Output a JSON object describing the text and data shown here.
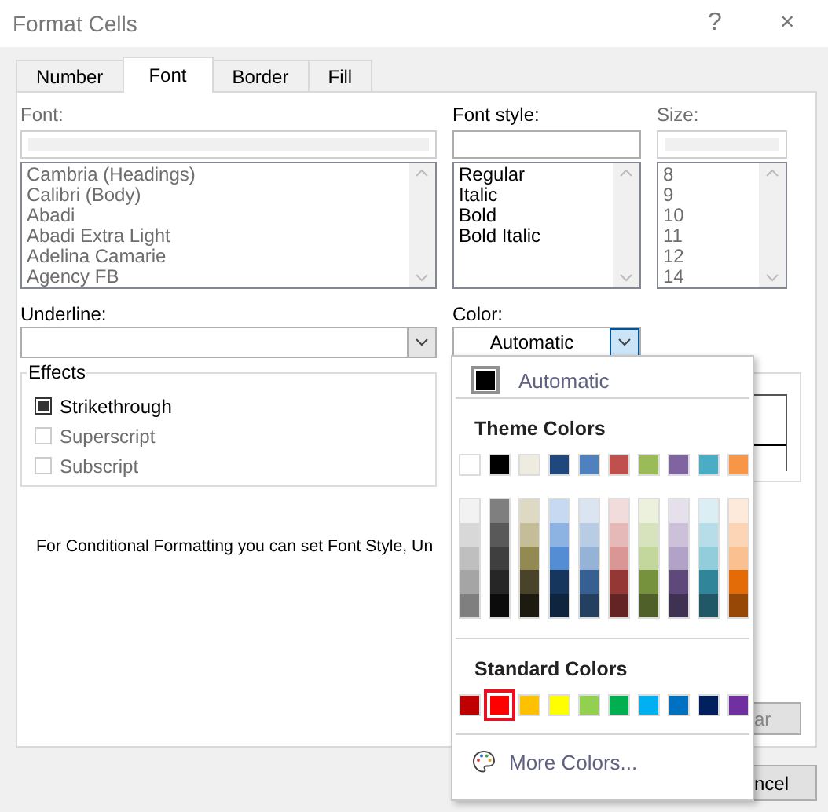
{
  "window": {
    "title": "Format Cells",
    "help": "?",
    "close": "×"
  },
  "tabs": [
    {
      "label": "Number",
      "selected": false
    },
    {
      "label": "Font",
      "selected": true
    },
    {
      "label": "Border",
      "selected": false
    },
    {
      "label": "Fill",
      "selected": false
    }
  ],
  "font": {
    "label": "Font:",
    "disabled": true,
    "items": [
      "Cambria (Headings)",
      "Calibri (Body)",
      "Abadi",
      "Abadi Extra Light",
      "Adelina Camarie",
      "Agency FB"
    ]
  },
  "font_style": {
    "label": "Font style:",
    "disabled": false,
    "items": [
      "Regular",
      "Italic",
      "Bold",
      "Bold Italic"
    ]
  },
  "size": {
    "label": "Size:",
    "disabled": true,
    "items": [
      "8",
      "9",
      "10",
      "11",
      "12",
      "14"
    ]
  },
  "underline": {
    "label": "Underline:"
  },
  "color": {
    "label": "Color:",
    "value": "Automatic"
  },
  "effects": {
    "title": "Effects",
    "options": [
      {
        "label": "Strikethrough",
        "checked": true,
        "disabled": false
      },
      {
        "label": "Superscript",
        "checked": false,
        "disabled": true
      },
      {
        "label": "Subscript",
        "checked": false,
        "disabled": true
      }
    ]
  },
  "note": "For Conditional Formatting you can set Font Style, Un",
  "hidden_buttons": {
    "clear": "ar",
    "cancel": "ncel"
  },
  "popup": {
    "automatic": "Automatic",
    "theme_title": "Theme Colors",
    "theme_colors": [
      {
        "color": "#ffffff"
      },
      {
        "color": "#000000"
      },
      {
        "color": "#eeece1"
      },
      {
        "color": "#1f497d"
      },
      {
        "color": "#4f81bd"
      },
      {
        "color": "#c0504d"
      },
      {
        "color": "#9bbb59"
      },
      {
        "color": "#8064a2"
      },
      {
        "color": "#4bacc6"
      },
      {
        "color": "#f79646"
      }
    ],
    "theme_shades": [
      [
        {
          "color": "#f2f2f2"
        },
        {
          "color": "#d8d8d8"
        },
        {
          "color": "#bfbfbf"
        },
        {
          "color": "#a5a5a5"
        },
        {
          "color": "#7f7f7f"
        }
      ],
      [
        {
          "color": "#7f7f7f"
        },
        {
          "color": "#595959"
        },
        {
          "color": "#3f3f3f"
        },
        {
          "color": "#262626"
        },
        {
          "color": "#0c0c0c"
        }
      ],
      [
        {
          "color": "#ddd9c3"
        },
        {
          "color": "#c4bd97"
        },
        {
          "color": "#938953"
        },
        {
          "color": "#494429"
        },
        {
          "color": "#1d1b10"
        }
      ],
      [
        {
          "color": "#c6d9f0"
        },
        {
          "color": "#8db3e2"
        },
        {
          "color": "#548dd4"
        },
        {
          "color": "#17365d"
        },
        {
          "color": "#0f243e"
        }
      ],
      [
        {
          "color": "#dbe5f1"
        },
        {
          "color": "#b8cce4"
        },
        {
          "color": "#95b3d7"
        },
        {
          "color": "#366092"
        },
        {
          "color": "#244061"
        }
      ],
      [
        {
          "color": "#f2dcdb"
        },
        {
          "color": "#e5b9b7"
        },
        {
          "color": "#d99694"
        },
        {
          "color": "#953734"
        },
        {
          "color": "#632423"
        }
      ],
      [
        {
          "color": "#ebf1dd"
        },
        {
          "color": "#d7e3bc"
        },
        {
          "color": "#c3d69b"
        },
        {
          "color": "#76923c"
        },
        {
          "color": "#4f6128"
        }
      ],
      [
        {
          "color": "#e5e0ec"
        },
        {
          "color": "#ccc1d9"
        },
        {
          "color": "#b2a2c7"
        },
        {
          "color": "#5f497a"
        },
        {
          "color": "#3f3151"
        }
      ],
      [
        {
          "color": "#dbeef3"
        },
        {
          "color": "#b7dde8"
        },
        {
          "color": "#92cddc"
        },
        {
          "color": "#31859b"
        },
        {
          "color": "#205867"
        }
      ],
      [
        {
          "color": "#fdeada"
        },
        {
          "color": "#fbd5b5"
        },
        {
          "color": "#fac08f"
        },
        {
          "color": "#e36c09"
        },
        {
          "color": "#974806"
        }
      ]
    ],
    "standard_title": "Standard Colors",
    "standard_colors": [
      {
        "color": "#c00000",
        "selected": false
      },
      {
        "color": "#ff0000",
        "selected": true
      },
      {
        "color": "#ffc000",
        "selected": false
      },
      {
        "color": "#ffff00",
        "selected": false
      },
      {
        "color": "#92d050",
        "selected": false
      },
      {
        "color": "#00b050",
        "selected": false
      },
      {
        "color": "#00b0f0",
        "selected": false
      },
      {
        "color": "#0070c0",
        "selected": false
      },
      {
        "color": "#002060",
        "selected": false
      },
      {
        "color": "#7030a0",
        "selected": false
      }
    ],
    "more_colors": "More Colors..."
  }
}
